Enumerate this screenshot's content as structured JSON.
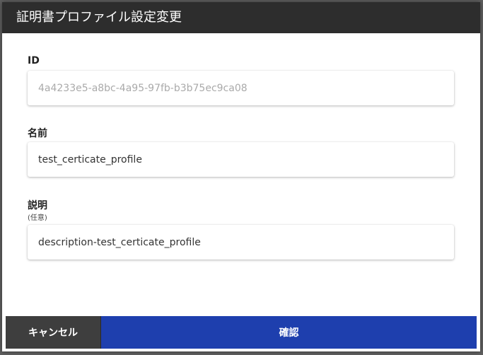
{
  "dialog": {
    "title": "証明書プロファイル設定変更"
  },
  "fields": {
    "id": {
      "label": "ID",
      "value": "4a4233e5-a8bc-4a95-97fb-b3b75ec9ca08"
    },
    "name": {
      "label": "名前",
      "value": "test_certicate_profile"
    },
    "description": {
      "label": "説明",
      "hint": "(任意)",
      "value": "description-test_certicate_profile"
    }
  },
  "footer": {
    "cancel_label": "キャンセル",
    "confirm_label": "確認"
  },
  "colors": {
    "titlebar": "#2d2d2d",
    "cancel_button": "#3e3e3e",
    "confirm_button": "#1e3fae"
  }
}
